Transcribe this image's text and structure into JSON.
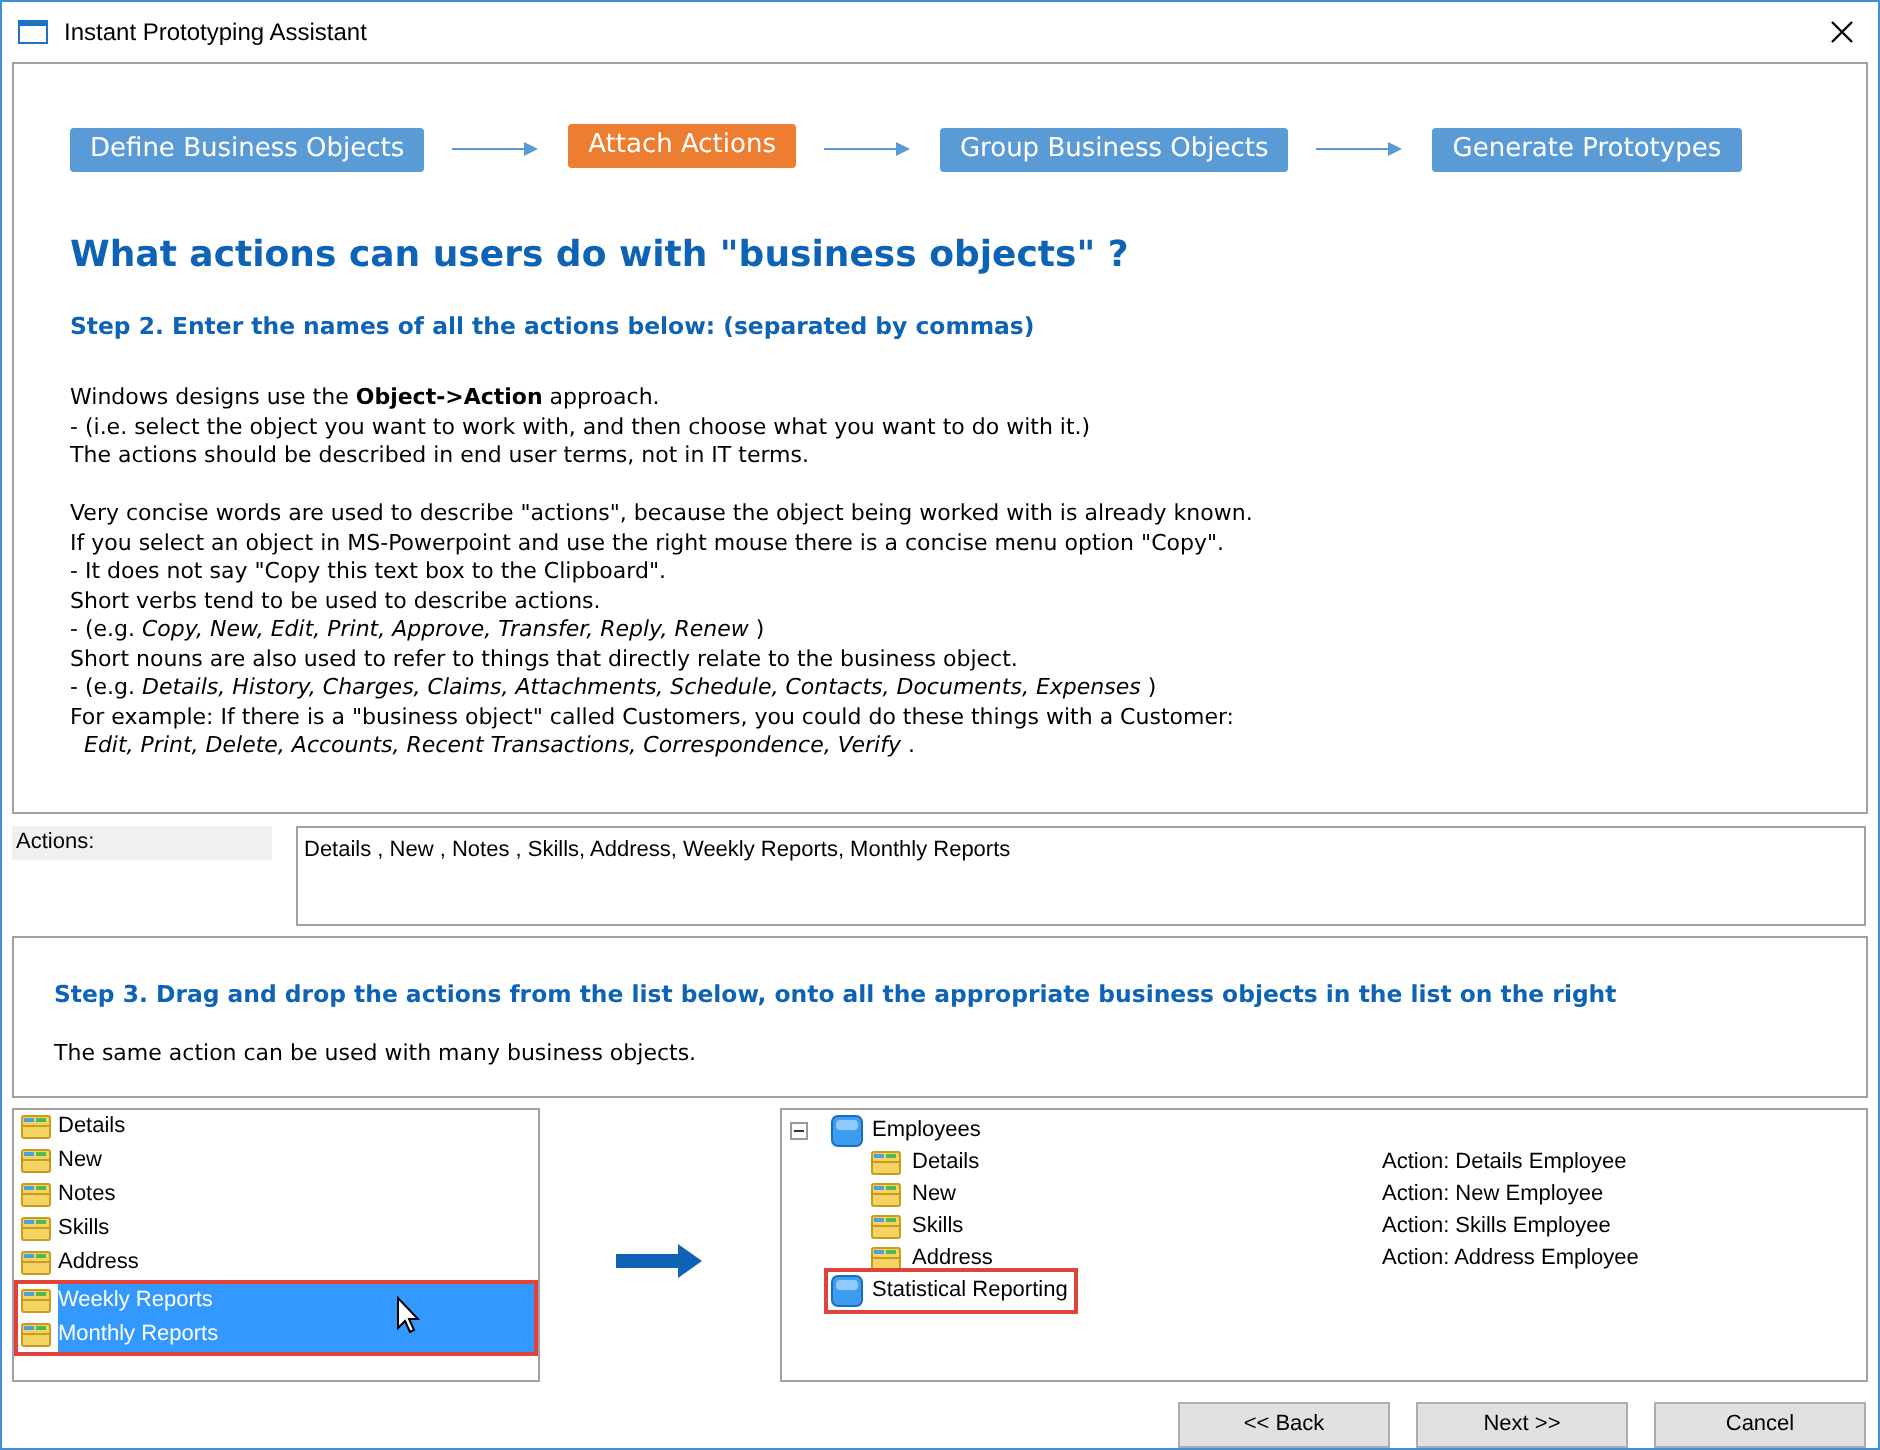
{
  "window": {
    "title": "Instant Prototyping Assistant"
  },
  "steps": [
    {
      "label": "Define Business Objects",
      "selected": false
    },
    {
      "label": "Attach Actions",
      "selected": true
    },
    {
      "label": "Group Business Objects",
      "selected": false
    },
    {
      "label": "Generate Prototypes",
      "selected": false
    }
  ],
  "heading": "What actions can users do with \"business objects\" ?",
  "step2": "Step 2. Enter the names of all the actions below: (separated by commas)",
  "paragraphs": [
    [
      "Windows designs use the **Object->Action** approach.",
      "- (i.e. select the object you want to work with, and then choose what you want to do with it.)",
      "The actions should be described in end user terms, not in IT terms."
    ],
    [
      "Very concise words are used to describe \"actions\", because the object being worked with is already known.",
      "If you select an object in MS-Powerpoint and use the right mouse there is a concise menu option \"Copy\".",
      "- It does not say \"Copy this text box to the Clipboard\".",
      "Short verbs tend to be used to describe actions.",
      "- (e.g. *Copy, New, Edit, Print, Approve, Transfer, Reply, Renew* )",
      "Short nouns are also used to refer to things that directly relate to the business object.",
      "- (e.g. *Details, History, Charges, Claims, Attachments, Schedule, Contacts, Documents, Expenses* )",
      "For example: If there is a \"business object\" called Customers, you could do these things with a Customer:",
      "  *Edit, Print, Delete, Accounts, Recent Transactions, Correspondence, Verify* ."
    ]
  ],
  "actions_field": {
    "label": "Actions:",
    "value": "Details , New , Notes , Skills, Address, Weekly Reports, Monthly Reports"
  },
  "step3": {
    "title": "Step 3. Drag and drop the actions from the list below, onto all the appropriate business objects in the list on the right",
    "note": "The same action can be used with many business objects."
  },
  "action_list": [
    {
      "label": "Details",
      "selected": false
    },
    {
      "label": "New",
      "selected": false
    },
    {
      "label": "Notes",
      "selected": false
    },
    {
      "label": "Skills",
      "selected": false
    },
    {
      "label": "Address",
      "selected": false
    },
    {
      "label": "Weekly Reports",
      "selected": true
    },
    {
      "label": "Monthly Reports",
      "selected": true
    }
  ],
  "object_tree": [
    {
      "label": "Employees",
      "expanded": true,
      "drop_target": false,
      "children": [
        {
          "label": "Details",
          "action": "Action: Details Employee"
        },
        {
          "label": "New",
          "action": "Action: New Employee"
        },
        {
          "label": "Skills",
          "action": "Action: Skills Employee"
        },
        {
          "label": "Address",
          "action": "Action: Address Employee"
        }
      ]
    },
    {
      "label": "Statistical Reporting",
      "drop_target": true
    }
  ],
  "buttons": [
    "<< Back",
    "Next >>",
    "Cancel"
  ]
}
